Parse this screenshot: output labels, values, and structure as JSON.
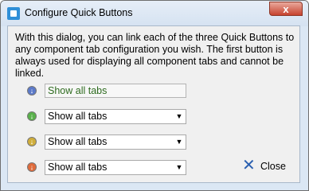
{
  "window": {
    "title": "Configure Quick Buttons",
    "close_glyph": "x"
  },
  "description": "With this dialog, you can link each of the three Quick Buttons to any component tab configuration you wish. The first button is always used for displaying all component tabs and cannot be linked.",
  "rows": [
    {
      "icon": "blue-arrow-icon",
      "color": "#5b79c9",
      "value": "Show all tabs",
      "editable": false
    },
    {
      "icon": "green-arrow-icon",
      "color": "#58b14a",
      "value": "Show all tabs",
      "editable": true
    },
    {
      "icon": "yellow-arrow-icon",
      "color": "#d0ae3a",
      "value": "Show all tabs",
      "editable": true
    },
    {
      "icon": "orange-arrow-icon",
      "color": "#e06b3b",
      "value": "Show all tabs",
      "editable": true
    }
  ],
  "close_button": {
    "label": "Close",
    "icon": "close-x-icon"
  }
}
